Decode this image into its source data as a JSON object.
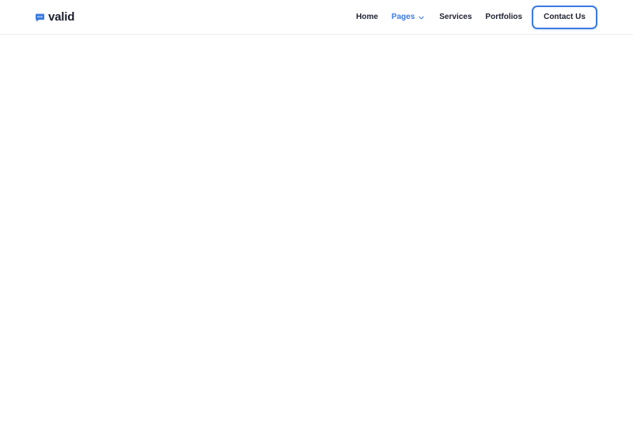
{
  "brand": {
    "name": "valid",
    "icon": "chat-bubble-icon",
    "color": "#3b7be0"
  },
  "nav": {
    "items": [
      {
        "label": "Home",
        "active": false
      },
      {
        "label": "Pages",
        "active": true,
        "has_dropdown": true
      },
      {
        "label": "Services",
        "active": false
      },
      {
        "label": "Portfolios",
        "active": false
      }
    ]
  },
  "cta": {
    "label": "Contact Us"
  },
  "colors": {
    "accent": "#3b7be0",
    "text": "#1f2230",
    "background": "#ffffff"
  }
}
